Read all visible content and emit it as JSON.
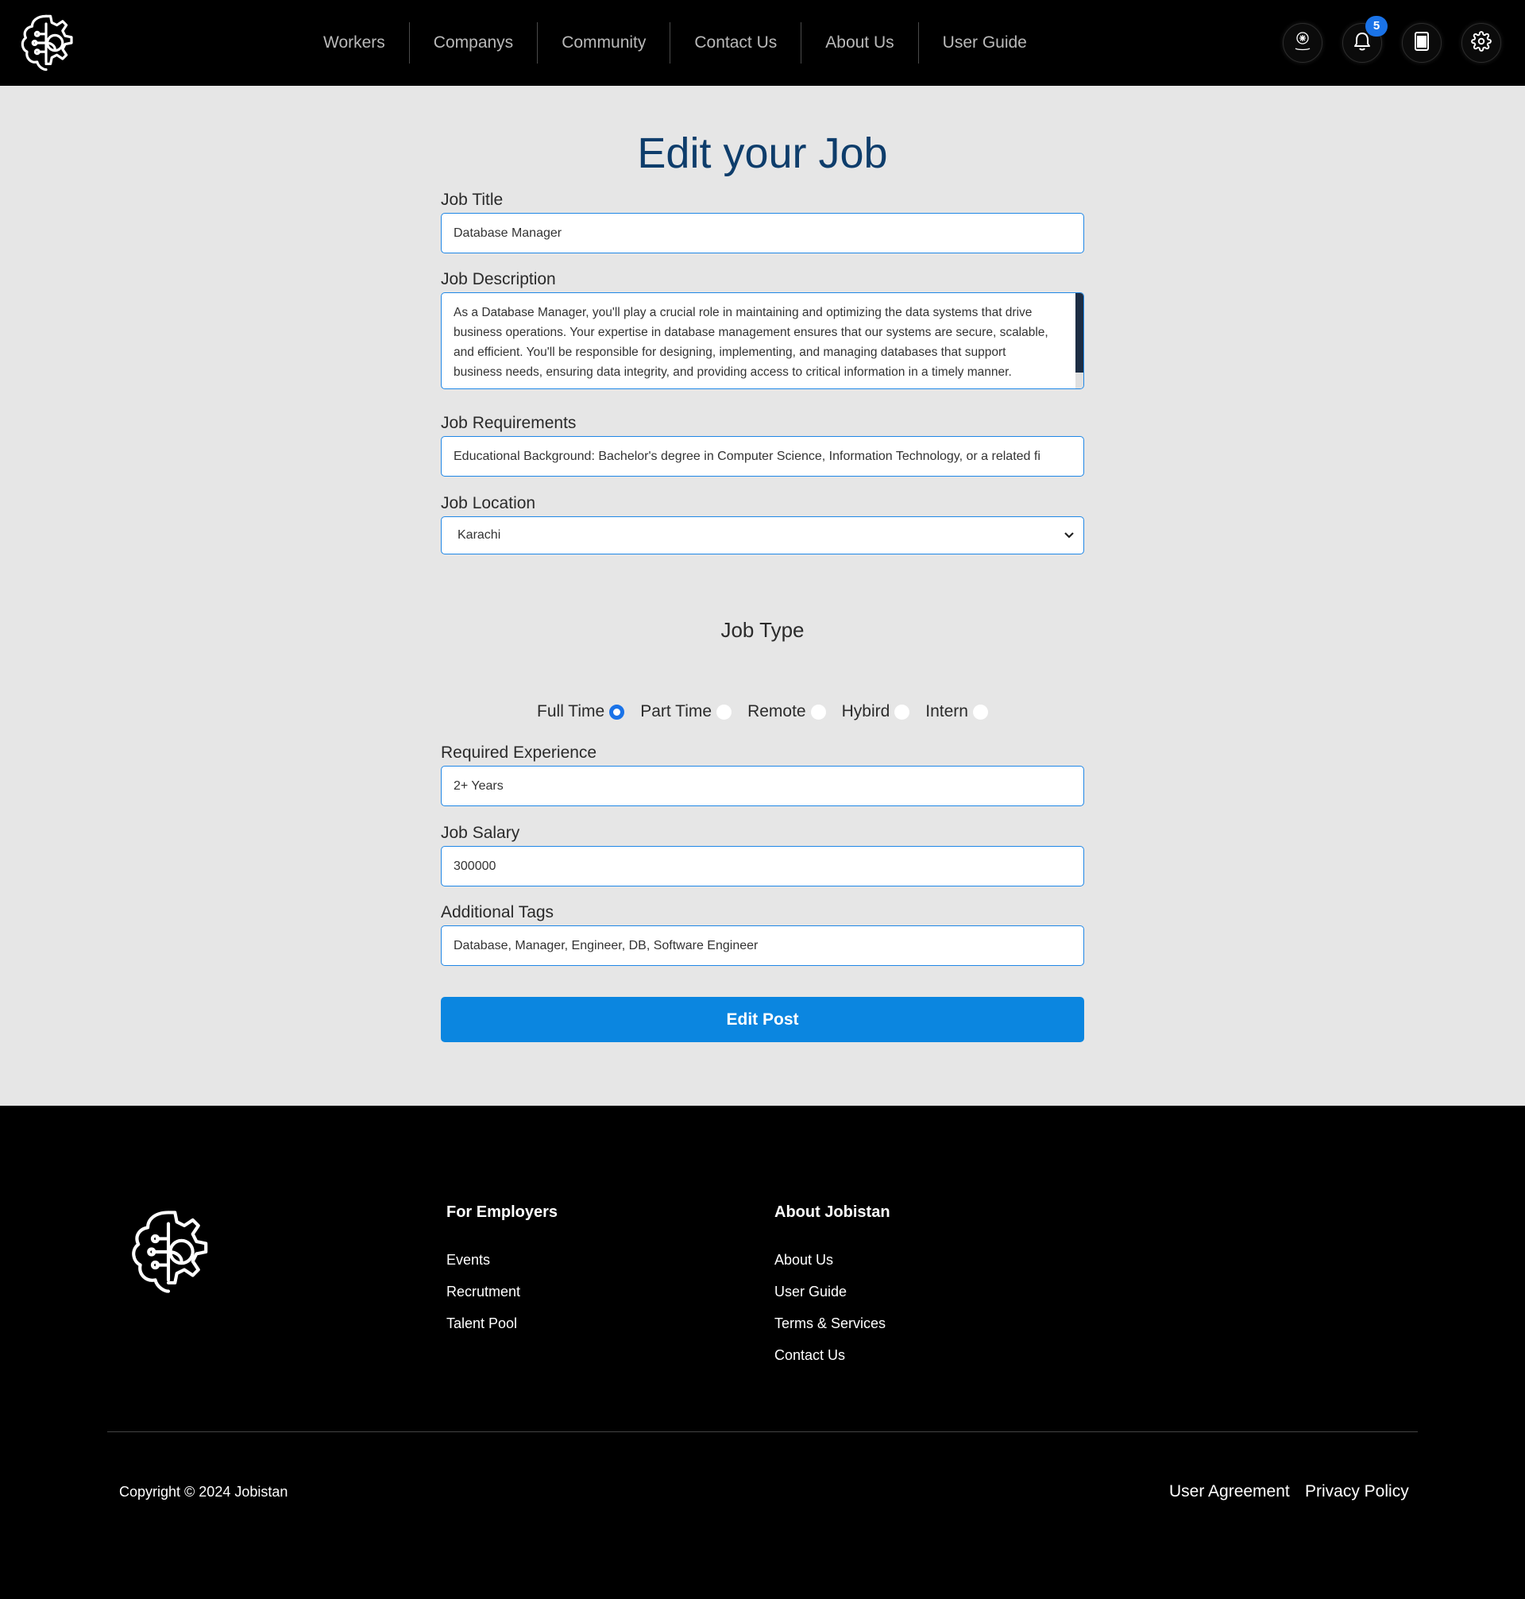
{
  "header": {
    "nav": [
      "Workers",
      "Companys",
      "Community",
      "Contact Us",
      "About Us",
      "User Guide"
    ],
    "notification_count": "5",
    "icons": [
      "brain-gear-logo-icon",
      "profile-avatar-icon",
      "bell-icon",
      "document-icon",
      "gear-icon"
    ]
  },
  "form": {
    "title": "Edit your Job",
    "job_title": {
      "label": "Job Title",
      "value": "Database Manager"
    },
    "job_description": {
      "label": "Job Description",
      "value": "As a Database Manager, you'll play a crucial role in maintaining and optimizing the data systems that drive business operations. Your expertise in database management ensures that our systems are secure, scalable, and efficient. You'll be responsible for designing, implementing, and managing databases that support business needs, ensuring data integrity, and providing access to critical information in a timely manner."
    },
    "job_requirements": {
      "label": "Job Requirements",
      "value": "Educational Background: Bachelor's degree in Computer Science, Information Technology, or a related fi"
    },
    "job_location": {
      "label": "Job Location",
      "value": "Karachi"
    },
    "job_type": {
      "label": "Job Type",
      "options": [
        "Full Time",
        "Part Time",
        "Remote",
        "Hybird",
        "Intern"
      ],
      "selected": "Full Time"
    },
    "required_experience": {
      "label": "Required Experience",
      "value": "2+ Years"
    },
    "job_salary": {
      "label": "Job Salary",
      "value": "300000"
    },
    "additional_tags": {
      "label": "Additional Tags",
      "value": "Database, Manager, Engineer, DB, Software Engineer"
    },
    "submit_label": "Edit Post"
  },
  "footer": {
    "employers": {
      "heading": "For Employers",
      "links": [
        "Events",
        "Recrutment",
        "Talent Pool"
      ]
    },
    "about": {
      "heading": "About Jobistan",
      "links": [
        "About Us",
        "User Guide",
        "Terms & Services",
        "Contact Us"
      ]
    },
    "copyright": "Copyright © 2024 Jobistan",
    "bottom_links": [
      "User Agreement",
      "Privacy Policy"
    ]
  },
  "colors": {
    "accent": "#0b86e0",
    "title": "#0e3d6b",
    "header_bg": "#000000",
    "page_bg": "#e6e6e6"
  }
}
